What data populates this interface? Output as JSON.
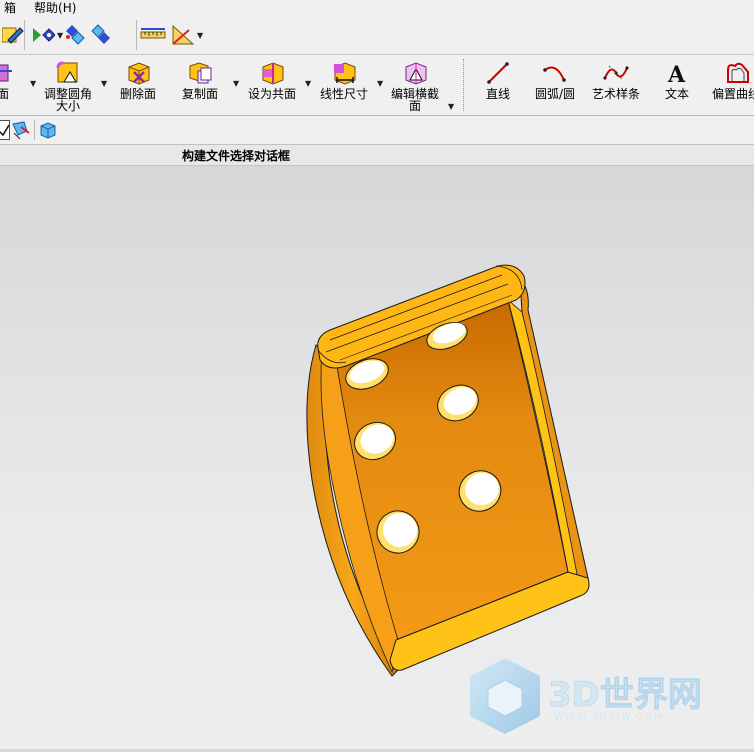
{
  "menu": {
    "items": [
      "箱",
      "帮助(H)"
    ]
  },
  "ribbon": {
    "buttons": [
      {
        "label": "面"
      },
      {
        "label": "调整圆角\n大小"
      },
      {
        "label": "删除面"
      },
      {
        "label": "复制面"
      },
      {
        "label": "设为共面"
      },
      {
        "label": "线性尺寸"
      },
      {
        "label": "编辑横截\n面"
      },
      {
        "label": "直线"
      },
      {
        "label": "圆弧/圆"
      },
      {
        "label": "艺术样条"
      },
      {
        "label": "文本"
      },
      {
        "label": "偏置曲线"
      }
    ]
  },
  "status": {
    "message": "构建文件选择对话框"
  },
  "watermark": {
    "brand": "3D世界网",
    "url": "WWW.3DSJW.COM"
  },
  "colors": {
    "part": "#f29a12",
    "part_light": "#ffc216",
    "part_dark": "#c86a00",
    "holes": "#ffe06a"
  },
  "icons": [
    "sketch-icon",
    "move-face-icon",
    "offset-region-icon",
    "replace-face-icon",
    "measure-distance-icon",
    "measure-angle-icon",
    "resize-blend-icon",
    "delete-face-icon",
    "copy-face-icon",
    "make-coplanar-icon",
    "linear-dimension-icon",
    "edit-section-icon",
    "line-icon",
    "arc-circle-icon",
    "studio-spline-icon",
    "text-icon",
    "offset-curve-icon",
    "selection-filter-icon",
    "solid-body-icon"
  ]
}
